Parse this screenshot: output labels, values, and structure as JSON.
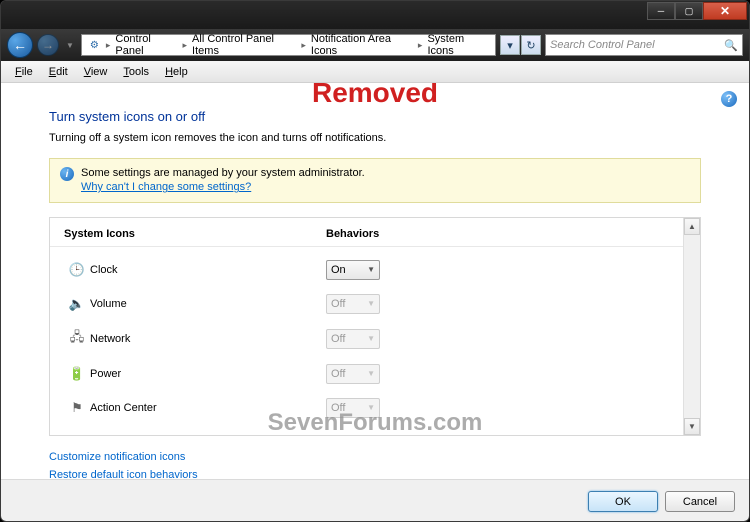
{
  "breadcrumb": {
    "items": [
      "Control Panel",
      "All Control Panel Items",
      "Notification Area Icons",
      "System Icons"
    ]
  },
  "search": {
    "placeholder": "Search Control Panel"
  },
  "menu": {
    "file": "File",
    "edit": "Edit",
    "view": "View",
    "tools": "Tools",
    "help": "Help"
  },
  "watermark": {
    "top": "Removed",
    "bottom": "SevenForums.com"
  },
  "page": {
    "title": "Turn system icons on or off",
    "desc": "Turning off a system icon removes the icon and turns off notifications."
  },
  "banner": {
    "text": "Some settings are managed by your system administrator.",
    "link": "Why can't I change some settings?"
  },
  "table": {
    "col1": "System Icons",
    "col2": "Behaviors",
    "rows": [
      {
        "icon": "clock-icon",
        "glyph": "🕒",
        "label": "Clock",
        "value": "On",
        "enabled": true
      },
      {
        "icon": "volume-icon",
        "glyph": "🔈",
        "label": "Volume",
        "value": "Off",
        "enabled": false
      },
      {
        "icon": "network-icon",
        "glyph": "🖧",
        "label": "Network",
        "value": "Off",
        "enabled": false
      },
      {
        "icon": "power-icon",
        "glyph": "🔋",
        "label": "Power",
        "value": "Off",
        "enabled": false
      },
      {
        "icon": "action-center-icon",
        "glyph": "⚑",
        "label": "Action Center",
        "value": "Off",
        "enabled": false
      }
    ]
  },
  "links": {
    "customize": "Customize notification icons",
    "restore": "Restore default icon behaviors"
  },
  "buttons": {
    "ok": "OK",
    "cancel": "Cancel"
  }
}
